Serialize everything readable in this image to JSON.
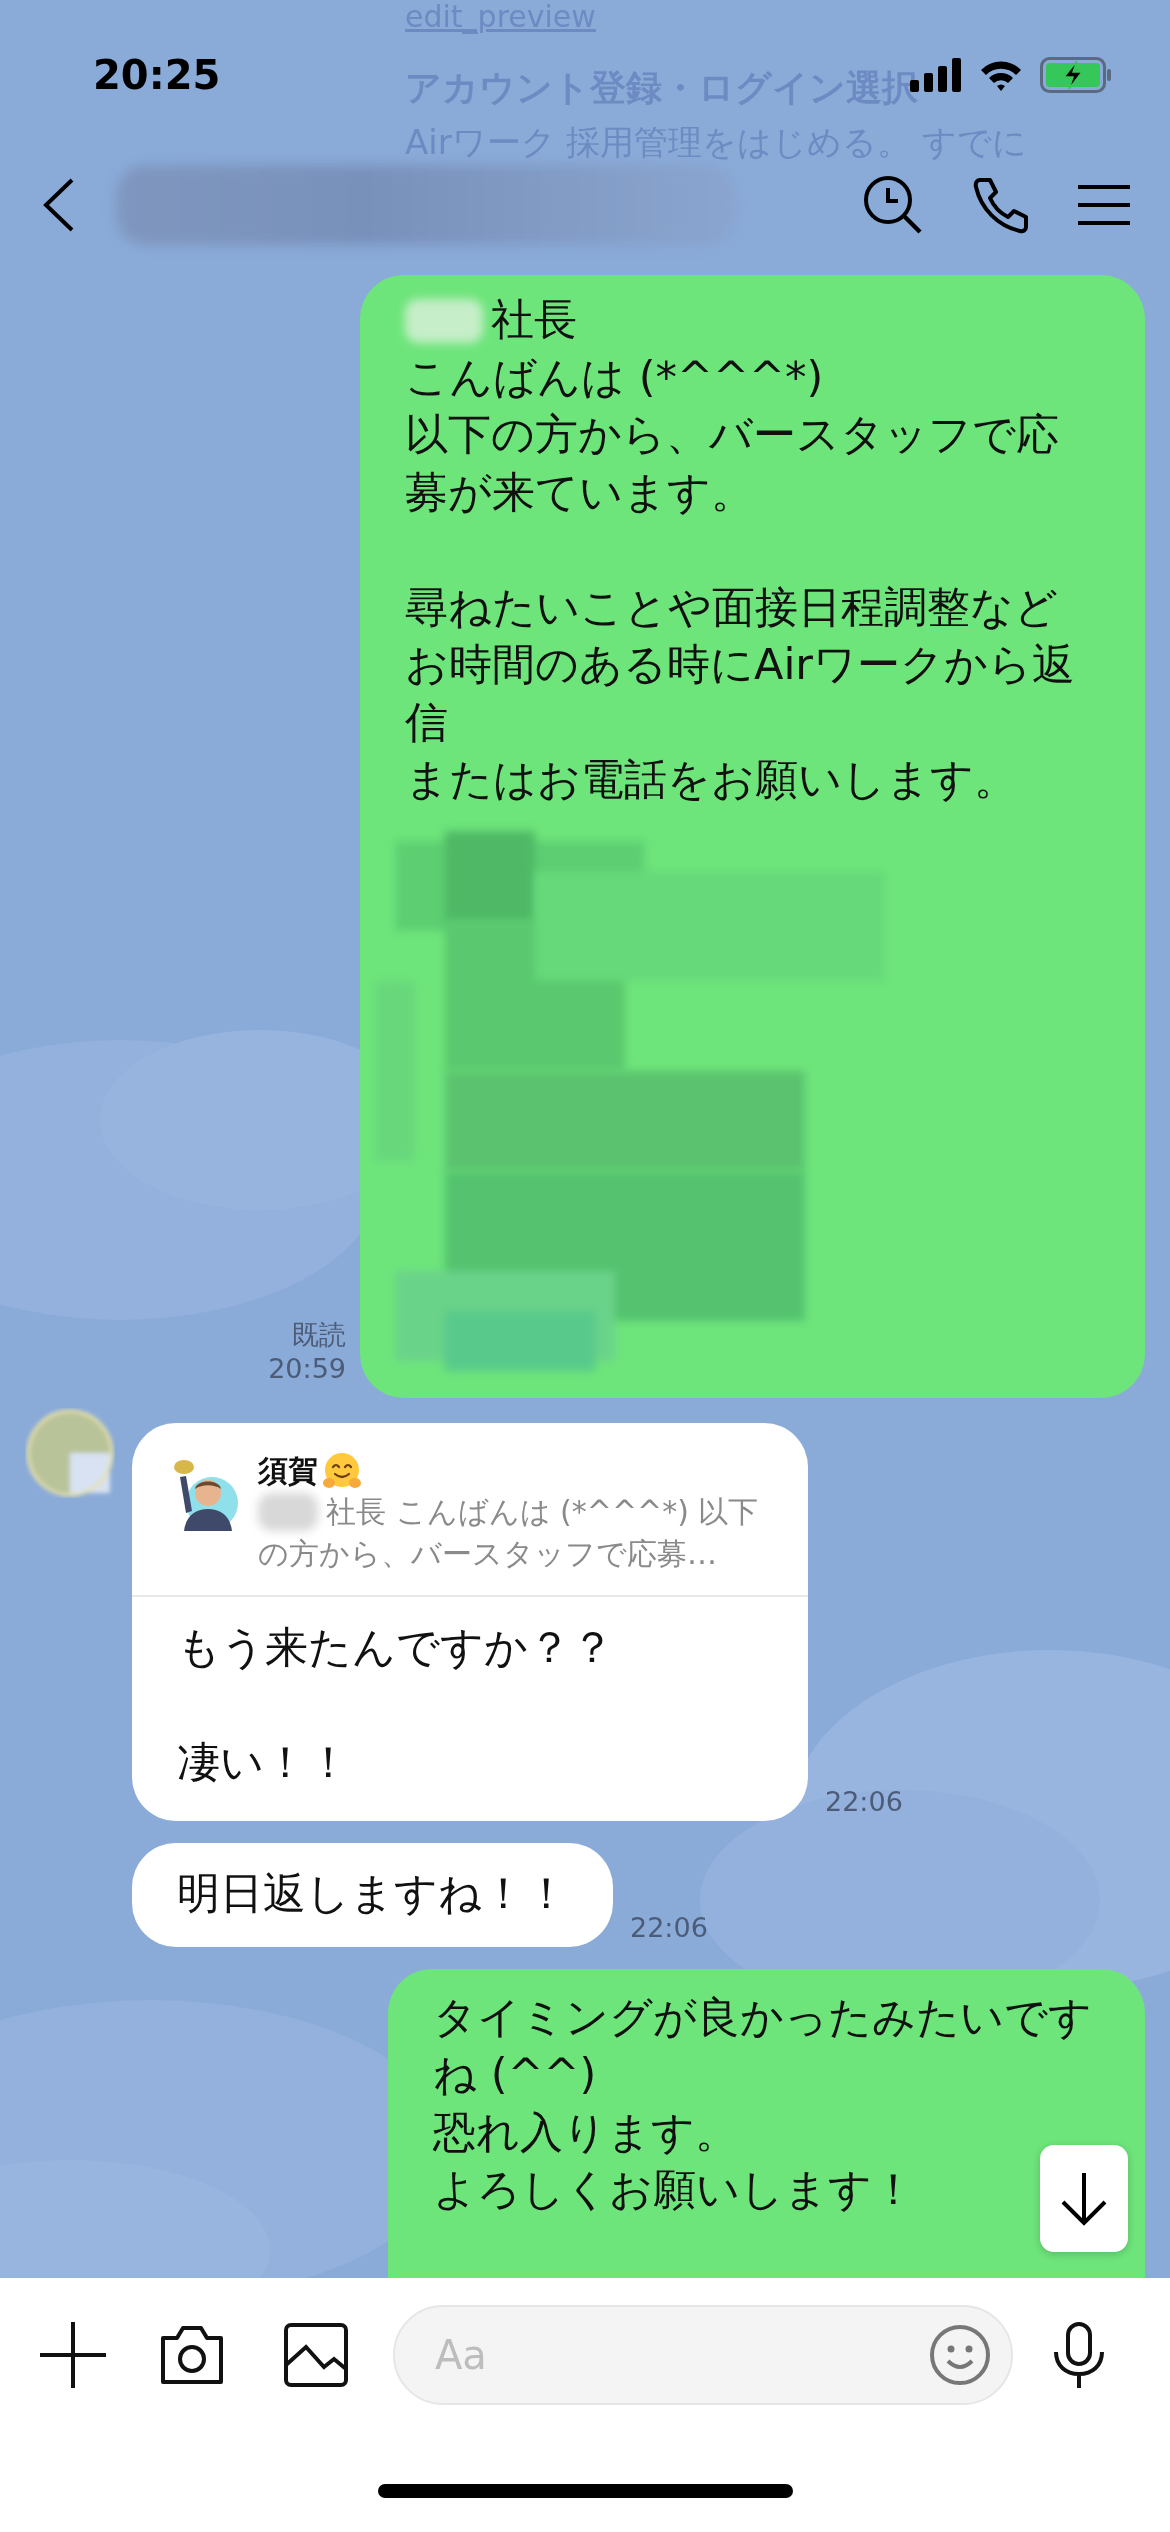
{
  "status_bar": {
    "time": "20:25"
  },
  "background_text": [
    "edit_preview",
    "アカウント登録・ログイン選択",
    "Airワーク 採用管理をはじめる。 すでに"
  ],
  "messages": [
    {
      "kind": "sent",
      "redacted_name": true,
      "paragraphs": [
        [
          "社長",
          "こんばんは (*^^^*)",
          "以下の方から、バースタッフで応",
          "募が来ています。"
        ],
        [
          "尋ねたいことや面接日程調整など",
          "お時間のある時にAirワークから返",
          "信",
          "またはお電話をお願いします。"
        ]
      ],
      "link_preview": true,
      "read": "既読",
      "time": "20:59"
    },
    {
      "kind": "received",
      "avatar": true,
      "reply_to": {
        "name": "須賀",
        "redacted_name": true,
        "lines": [
          "社長 こんばんは (*^^^*) 以下",
          "の方から、バースタッフで応募…"
        ]
      },
      "paragraphs": [
        [
          "もう来たんですか？？"
        ],
        [
          "凄い！！"
        ]
      ],
      "time": "22:06"
    },
    {
      "kind": "received",
      "paragraphs": [
        [
          "明日返しますね！！"
        ]
      ],
      "time": "22:06"
    },
    {
      "kind": "sent",
      "paragraphs": [
        [
          "タイミングが良かったみたいです",
          "ね (^^)",
          "恐れ入ります。",
          "よろしくお願いします！"
        ]
      ]
    }
  ],
  "input": {
    "placeholder": "Aa"
  }
}
